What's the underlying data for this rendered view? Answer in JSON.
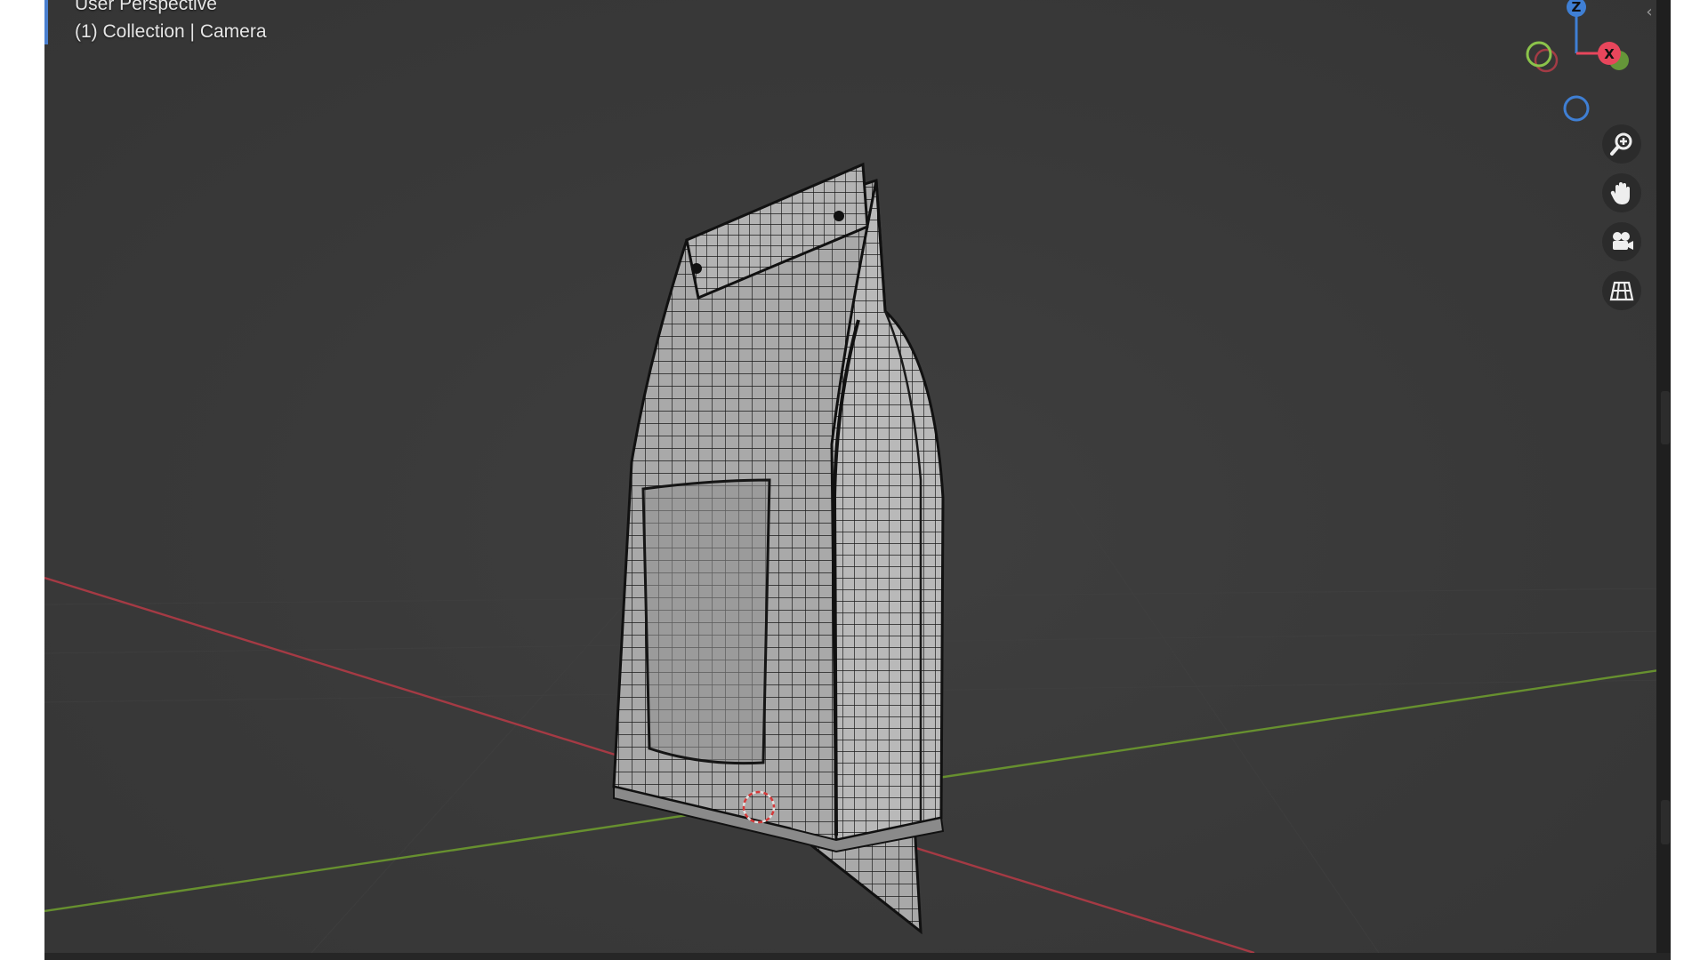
{
  "viewport": {
    "perspective_label": "User Perspective",
    "collection_label": "(1) Collection | Camera"
  },
  "gizmo": {
    "z_label": "Z",
    "x_label": "X",
    "colors": {
      "x": "#e8465c",
      "y": "#8bc34a",
      "z": "#3f7fd4"
    }
  },
  "navigation": {
    "zoom": "zoom-icon",
    "pan": "hand-icon",
    "camera": "camera-icon",
    "ortho": "grid-icon"
  },
  "axes": {
    "x_color": "#b0353f",
    "y_color": "#6a8f2e"
  }
}
